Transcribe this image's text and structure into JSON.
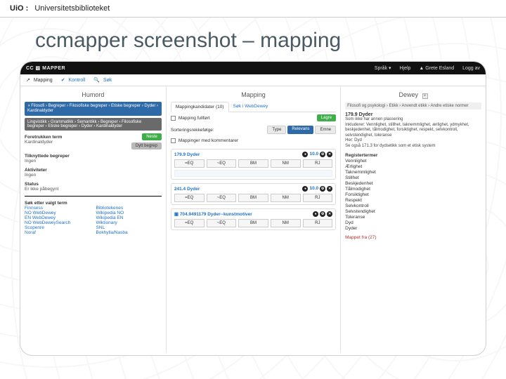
{
  "uio": {
    "brand": "UiO :",
    "dept": "Universitetsbiblioteket"
  },
  "slide_title": "ccmapper screenshot – mapping",
  "app": {
    "brand": "CC ▨ MAPPER",
    "rhs": {
      "lang": "Språk ▾",
      "help": "Hjelp",
      "user": "▲ Grete Esland",
      "logout": "Logg av"
    }
  },
  "tabs": {
    "mapping": "Mapping",
    "kontroll": "Kontroll",
    "sok": "Søk",
    "icon_map": "↗",
    "icon_check": "✔",
    "icon_search": "🔍"
  },
  "left": {
    "heading": "Humord",
    "breadcrumb1": "◑ Filosofi › Begreper › Filosofiske begreper › Etiske begreper › Dyder › Kardinaldyder",
    "breadcrumb2": "Lingvistikk › Grammatikk › Semantikk › Begreper › Filosofiske begreper › Etiske begreper › Dyder › Kardinaldyder",
    "term_label": "Foretrukken term",
    "term_value": "Kardinaldyder",
    "btn_next": "Neste",
    "btn_deep": "Dytt begrep",
    "rel_label": "Tilknyttede begreper",
    "rel_value": "Ingen",
    "act_label": "Aktiviteter",
    "act_value": "Ingen",
    "status_label": "Status",
    "status_value": "Er ikke påbegynt",
    "search_hdr": "Søk etter valgt term",
    "links_left": [
      "Finnsess",
      "NO WebDewey",
      "EN WebDewey",
      "NO WebDeweySearch",
      "Scopenre",
      "Noraf"
    ],
    "links_right": [
      "Bibliotekenes",
      "Wikipedia NO",
      "Wikipedia EN",
      "Wiktionary",
      "SNL",
      "Bokhylla/Nasba"
    ]
  },
  "mid": {
    "heading": "Mapping",
    "tab1": "Mappingkandidater (10)",
    "tab2": "Søk i WebDewey",
    "chk1": "Mapping fullført",
    "btn_save": "Lagre",
    "sort_label": "Sorteringsrekkefølge:",
    "sort_opts": [
      "Type",
      "Relevans",
      "Emne"
    ],
    "chk2": "Mappinger med kommentarer",
    "map_rel": [
      "=EQ",
      "~EQ",
      "BM",
      "NM",
      "RJ"
    ],
    "cards": [
      {
        "title": "179.9 Dyder",
        "pills": [
          "●",
          "10.0",
          "⚙",
          "✕"
        ]
      },
      {
        "title": "241.4 Dyder",
        "pills": [
          "●",
          "10.0",
          "⚙",
          "✕"
        ]
      },
      {
        "title": "▣ 704.9491179 Dyder--kunstmotiver",
        "pills": [
          "●",
          "⚙",
          "✕"
        ]
      }
    ]
  },
  "right": {
    "heading": "Dewey",
    "plus": "+",
    "crumb": "Filosofi og psykologi › Etikk › Anvendt etikk › Andre etiske normer",
    "title": "179.9 Dyder",
    "body1": "Som ikke har annen plassering",
    "body2": "Inkluderer: Vennlighet, stillhet, taknemmlighet, ærlighet, ydmykhet, beskjedenhet, tålmodighet, forsiktighet, respekt, selvkontroll, selvstendighet, toleranse",
    "body3": "Her: Dyd",
    "body4": "Se også 171.3 for dydsetikk som et etisk system",
    "reg_hdr": "Registertermer",
    "reg": [
      "Vennlighet",
      "Ærlighet",
      "Taknemmlighet",
      "Stillhet",
      "Beskjedenhet",
      "Tålmodighet",
      "Forsiktighet",
      "Respekt",
      "Selvkontroll",
      "Selvstendighet",
      "Toleranse",
      "Dyd",
      "Dyder"
    ],
    "mapped": "Mappet fra (27)"
  }
}
